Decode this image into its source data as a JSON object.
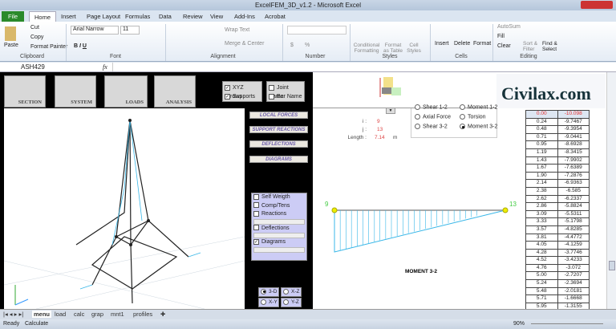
{
  "window": {
    "title": "ExcelFEM_3D_v1.2 - Microsoft Excel"
  },
  "ribbon_tabs": [
    "File",
    "Home",
    "Insert",
    "Page Layout",
    "Formulas",
    "Data",
    "Review",
    "View",
    "Add-Ins",
    "Acrobat"
  ],
  "ribbon": {
    "clipboard": {
      "paste": "Paste",
      "cut": "Cut",
      "copy": "Copy",
      "format_painter": "Format Painter",
      "label": "Clipboard"
    },
    "font": {
      "name": "Arial Narrow",
      "size": "11",
      "label": "Font"
    },
    "alignment": {
      "wrap": "Wrap Text",
      "merge": "Merge & Center",
      "label": "Alignment"
    },
    "number": {
      "label": "Number",
      "currency": "$",
      "percent": "%"
    },
    "styles": {
      "conditional": "Conditional Formatting",
      "format_table": "Format as Table",
      "cell_styles": "Cell Styles",
      "label": "Styles"
    },
    "cells": {
      "insert": "Insert",
      "delete": "Delete",
      "format": "Format",
      "label": "Cells"
    },
    "editing": {
      "autosum": "AutoSum",
      "fill": "Fill",
      "clear": "Clear",
      "sort": "Sort & Filter",
      "find": "Find & Select",
      "label": "Editing"
    }
  },
  "formula_bar": {
    "name_box": "ASH429",
    "fx": "fx",
    "value": ""
  },
  "toolbar_buttons": [
    "SECTION",
    "SYSTEM",
    "LOADS",
    "ANALYSIS"
  ],
  "display_options": [
    {
      "label": "XYZ Arrows",
      "checked": true
    },
    {
      "label": "Supports",
      "checked": true
    },
    {
      "label": "Joint Name",
      "checked": false
    },
    {
      "label": "Bar Name",
      "checked": false
    }
  ],
  "panel_buttons": [
    "LOCAL FORCES",
    "SUPPORT REACTIONS",
    "DEFLECTIONS",
    "DIAGRAMS"
  ],
  "view_options": [
    {
      "label": "Self Weigth",
      "checked": false
    },
    {
      "label": "Comp/Tens",
      "checked": false
    },
    {
      "label": "Reactions",
      "checked": false
    },
    {
      "label": "Deflections",
      "checked": false
    },
    {
      "label": "Diagrams",
      "checked": true
    }
  ],
  "view_modes": [
    {
      "label": "3-D",
      "selected": true
    },
    {
      "label": "X-Z",
      "selected": false
    },
    {
      "label": "X-Y",
      "selected": false
    },
    {
      "label": "Y-Z",
      "selected": false
    }
  ],
  "member": {
    "i_label": "i :",
    "i": "9",
    "j_label": "j :",
    "j": "13",
    "length_label": "Length :",
    "length": "7.14",
    "unit": "m"
  },
  "force_types": [
    {
      "label": "Shear 1-2",
      "selected": false
    },
    {
      "label": "Moment 1-2",
      "selected": false
    },
    {
      "label": "Axial Force",
      "selected": false
    },
    {
      "label": "Torsion",
      "selected": false
    },
    {
      "label": "Shear 3-2",
      "selected": false
    },
    {
      "label": "Moment 3-2",
      "selected": true
    }
  ],
  "diagram": {
    "title": "MOMENT 3-2",
    "node_i": "9",
    "node_j": "13",
    "start_value": -10.098,
    "end_value": 0
  },
  "logo": "Civilax.com",
  "table": [
    [
      "0.00",
      "-10.098"
    ],
    [
      "0.24",
      "-9.7467"
    ],
    [
      "0.48",
      "-9.3954"
    ],
    [
      "0.71",
      "-9.0441"
    ],
    [
      "0.95",
      "-8.6928"
    ],
    [
      "1.19",
      "-8.3415"
    ],
    [
      "1.43",
      "-7.9902"
    ],
    [
      "1.67",
      "-7.6389"
    ],
    [
      "1.90",
      "-7.2876"
    ],
    [
      "2.14",
      "-6.9363"
    ],
    [
      "2.38",
      "-6.585"
    ],
    [
      "2.62",
      "-6.2337"
    ],
    [
      "2.86",
      "-5.8824"
    ],
    [
      "3.09",
      "-5.5311"
    ],
    [
      "3.33",
      "-5.1798"
    ],
    [
      "3.57",
      "-4.8285"
    ],
    [
      "3.81",
      "-4.4772"
    ],
    [
      "4.05",
      "-4.1259"
    ],
    [
      "4.28",
      "-3.7746"
    ],
    [
      "4.52",
      "-3.4233"
    ],
    [
      "4.76",
      "-3.072"
    ],
    [
      "5.00",
      "-2.7207"
    ],
    [
      "5.24",
      "-2.3694"
    ],
    [
      "5.48",
      "-2.0181"
    ],
    [
      "5.71",
      "-1.6668"
    ],
    [
      "5.95",
      "-1.3155"
    ]
  ],
  "sheet_tabs": [
    "menu",
    "load",
    "calc",
    "grap",
    "mnt1",
    "profiles"
  ],
  "status": {
    "ready": "Ready",
    "calculate": "Calculate",
    "zoom": "90%"
  },
  "colors": {
    "diagram": "#39b7e8",
    "accent": "#2a8a2a",
    "highlight": "#e53030"
  }
}
